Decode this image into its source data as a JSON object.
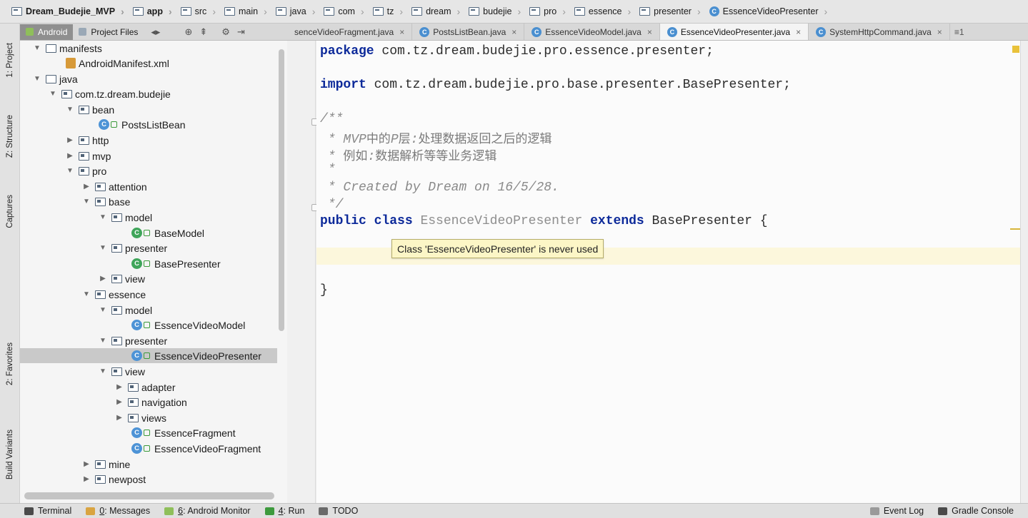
{
  "breadcrumb": [
    {
      "label": "Dream_Budejie_MVP",
      "icon": "folder"
    },
    {
      "label": "app",
      "icon": "folder"
    },
    {
      "label": "src",
      "icon": "folder"
    },
    {
      "label": "main",
      "icon": "folder"
    },
    {
      "label": "java",
      "icon": "folder"
    },
    {
      "label": "com",
      "icon": "folder"
    },
    {
      "label": "tz",
      "icon": "folder"
    },
    {
      "label": "dream",
      "icon": "folder"
    },
    {
      "label": "budejie",
      "icon": "folder"
    },
    {
      "label": "pro",
      "icon": "folder"
    },
    {
      "label": "essence",
      "icon": "folder"
    },
    {
      "label": "presenter",
      "icon": "folder"
    },
    {
      "label": "EssenceVideoPresenter",
      "icon": "class"
    }
  ],
  "left_strip": {
    "project": "1: Project",
    "structure": "Z: Structure",
    "captures": "Captures",
    "favorites": "2: Favorites",
    "build_variants": "Build Variants"
  },
  "project_panel": {
    "android_tab": "Android",
    "project_files_tab": "Project Files"
  },
  "editor_tabs": [
    {
      "label": "senceVideoFragment.java",
      "close": "×"
    },
    {
      "label": "PostsListBean.java",
      "close": "×"
    },
    {
      "label": "EssenceVideoModel.java",
      "close": "×"
    },
    {
      "label": "EssenceVideoPresenter.java",
      "close": "×"
    },
    {
      "label": "SystemHttpCommand.java",
      "close": "×"
    }
  ],
  "editor_tab_menu": "≡1",
  "tree": [
    {
      "label": "manifests"
    },
    {
      "label": "AndroidManifest.xml"
    },
    {
      "label": "java"
    },
    {
      "label": "com.tz.dream.budejie"
    },
    {
      "label": "bean"
    },
    {
      "label": "PostsListBean"
    },
    {
      "label": "http"
    },
    {
      "label": "mvp"
    },
    {
      "label": "pro"
    },
    {
      "label": "attention"
    },
    {
      "label": "base"
    },
    {
      "label": "model"
    },
    {
      "label": "BaseModel"
    },
    {
      "label": "presenter"
    },
    {
      "label": "BasePresenter"
    },
    {
      "label": "view"
    },
    {
      "label": "essence"
    },
    {
      "label": "model"
    },
    {
      "label": "EssenceVideoModel"
    },
    {
      "label": "presenter"
    },
    {
      "label": "EssenceVideoPresenter"
    },
    {
      "label": "view"
    },
    {
      "label": "adapter"
    },
    {
      "label": "navigation"
    },
    {
      "label": "views"
    },
    {
      "label": "EssenceFragment"
    },
    {
      "label": "EssenceVideoFragment"
    },
    {
      "label": "mine"
    },
    {
      "label": "newpost"
    }
  ],
  "code": {
    "package_kw": "package",
    "package_name": " com.tz.dream.budejie.pro.essence.presenter;",
    "import_kw": "import",
    "import_name": " com.tz.dream.budejie.pro.base.presenter.BasePresenter;",
    "doc_open": "/**",
    "doc_line1_star": " * ",
    "doc_line1_a": "MVP",
    "doc_line1_b": "中的",
    "doc_line1_c": "P",
    "doc_line1_d": "层",
    "doc_line1_e": ":",
    "doc_line1_f": "处理数据返回之后的逻辑",
    "doc_line2_star": " * ",
    "doc_line2_a": "例如",
    "doc_line2_b": ":",
    "doc_line2_c": "数据解析等等业务逻辑",
    "doc_line3": " *",
    "doc_line4": " * Created by Dream on 16/5/28.",
    "doc_close": " */",
    "kw_public": "public",
    "kw_class": "class",
    "class_name": "EssenceVideoPresenter",
    "kw_extends": "extends",
    "super_name": "BasePresenter {",
    "close_brace": "}"
  },
  "tooltip": "Class 'EssenceVideoPresenter' is never used",
  "status_bar": {
    "terminal": "Terminal",
    "messages_key": "0",
    "messages": ": Messages",
    "monitor_key": "6",
    "monitor": ": Android Monitor",
    "run_key": "4",
    "run": ": Run",
    "todo": "TODO",
    "event_log": "Event Log",
    "gradle_console": "Gradle Console"
  },
  "colors": {
    "keyword": "#0d2a9a",
    "comment": "#8a8a8a",
    "selected_row": "#c9c9c9",
    "tooltip_bg": "#fcf6c6",
    "class_icon": "#4d93d6"
  }
}
